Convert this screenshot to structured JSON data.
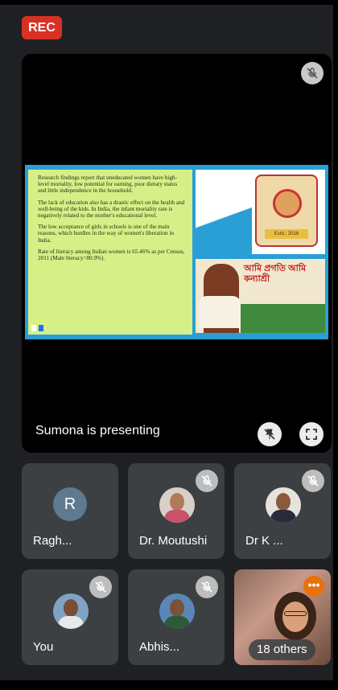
{
  "recording": {
    "badge": "REC",
    "color": "#d93025"
  },
  "stage": {
    "presenting_text": "Sumona is presenting",
    "mic_icon": "mic-off-icon",
    "controls": [
      "unpin-icon",
      "fullscreen-icon"
    ],
    "slide": {
      "bullets": [
        "Research findings report that uneducated women have high-level mortality, low potential for earning, poor dietary status and little independence in the household.",
        "The lack of education also has a drastic effect on the health and well-being of the kids. In India, the infant mortality rate is negatively related to the mother's educational level.",
        "The low acceptance of girls in schools is one of the main reasons, which hurdles in the way of women's liberation in India.",
        "Rate of literacy among Indian women is 65.46% as per Census, 2011 (Male literacy=80.9%)."
      ],
      "emblem_text": "Estd.: 2016",
      "bengali_text": "আমি প্রগতি আমি কন্যাশ্রী"
    }
  },
  "participants": [
    {
      "name": "Ragh...",
      "initial": "R",
      "muted": false,
      "avatar": "initial"
    },
    {
      "name": "Dr. Moutushi",
      "muted": true,
      "avatar": "photo"
    },
    {
      "name": "Dr K ...",
      "muted": true,
      "avatar": "photo"
    },
    {
      "name": "You",
      "muted": true,
      "avatar": "photo"
    },
    {
      "name": "Abhis...",
      "muted": true,
      "avatar": "photo"
    },
    {
      "name": "18 others",
      "avatar": "video"
    }
  ]
}
